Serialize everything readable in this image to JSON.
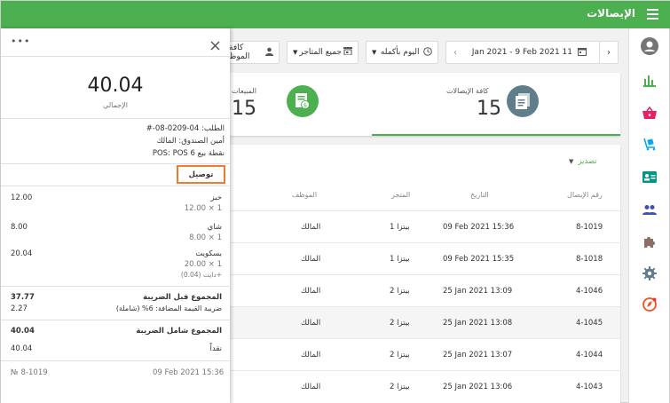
{
  "app": {
    "title": "الإيصالات"
  },
  "date_range": "Jan 2021 - 9 Feb 2021 11",
  "time_filter": "اليوم بأكمله",
  "store_filter": "جميع المتاجر",
  "employee_filter": "كافة الموظ",
  "summary": {
    "all_receipts_label": "كافة الإيصالات",
    "all_receipts_value": "15",
    "sales_label": "المبيعات",
    "sales_value": "15"
  },
  "export_label": "تصدير",
  "table": {
    "headers": {
      "receipt_no": "رقم الإيصال",
      "date": "التاريخ",
      "store": "المتجر",
      "employee": "الموظف"
    },
    "rows": [
      {
        "id": "8-1019",
        "date": "09 Feb 2021 15:36",
        "store": "بيتزا 1",
        "employee": "المالك"
      },
      {
        "id": "8-1018",
        "date": "09 Feb 2021 15:35",
        "store": "بيتزا 1",
        "employee": "المالك"
      },
      {
        "id": "4-1046",
        "date": "25 Jan 2021 13:09",
        "store": "بيتزا 2",
        "employee": "المالك"
      },
      {
        "id": "4-1045",
        "date": "25 Jan 2021 13:08",
        "store": "بيتزا 2",
        "employee": "المالك"
      },
      {
        "id": "4-1044",
        "date": "25 Jan 2021 13:07",
        "store": "بيتزا 2",
        "employee": "المالك"
      },
      {
        "id": "4-1043",
        "date": "25 Jan 2021 13:06",
        "store": "بيتزا 2",
        "employee": "المالك"
      }
    ]
  },
  "receipt": {
    "total": "40.04",
    "total_label": "الإجمالي",
    "order_line": "الطلب: 04-0209-08-#",
    "cashier_line": "أمين الصندوق: المالك",
    "pos_line": "نقطة بيع POS: POS 6",
    "dining_option": "توصيل",
    "items": [
      {
        "name": "خبز",
        "price": "12.00",
        "detail": "1 × 12.00",
        "extra": ""
      },
      {
        "name": "شاي",
        "price": "8.00",
        "detail": "1 × 8.00",
        "extra": ""
      },
      {
        "name": "بسكويت",
        "price": "20.04",
        "detail": "1 × 20.00",
        "extra": "+دايت (0.04)"
      }
    ],
    "subtotal_label": "المجموع قبل الضريبة",
    "subtotal": "37.77",
    "vat_label": "ضريبة القيمة المضافة: 6% (شاملة)",
    "vat": "2.27",
    "total_with_tax_label": "المجموع شامل الضريبة",
    "total_with_tax": "40.04",
    "payment_label": "نقداً",
    "payment": "40.04",
    "footer_date": "09 Feb 2021 15:36",
    "footer_no": "№ 8-1019"
  },
  "colors": {
    "brand_green": "#4caf50",
    "highlight": "#f07c2b"
  }
}
